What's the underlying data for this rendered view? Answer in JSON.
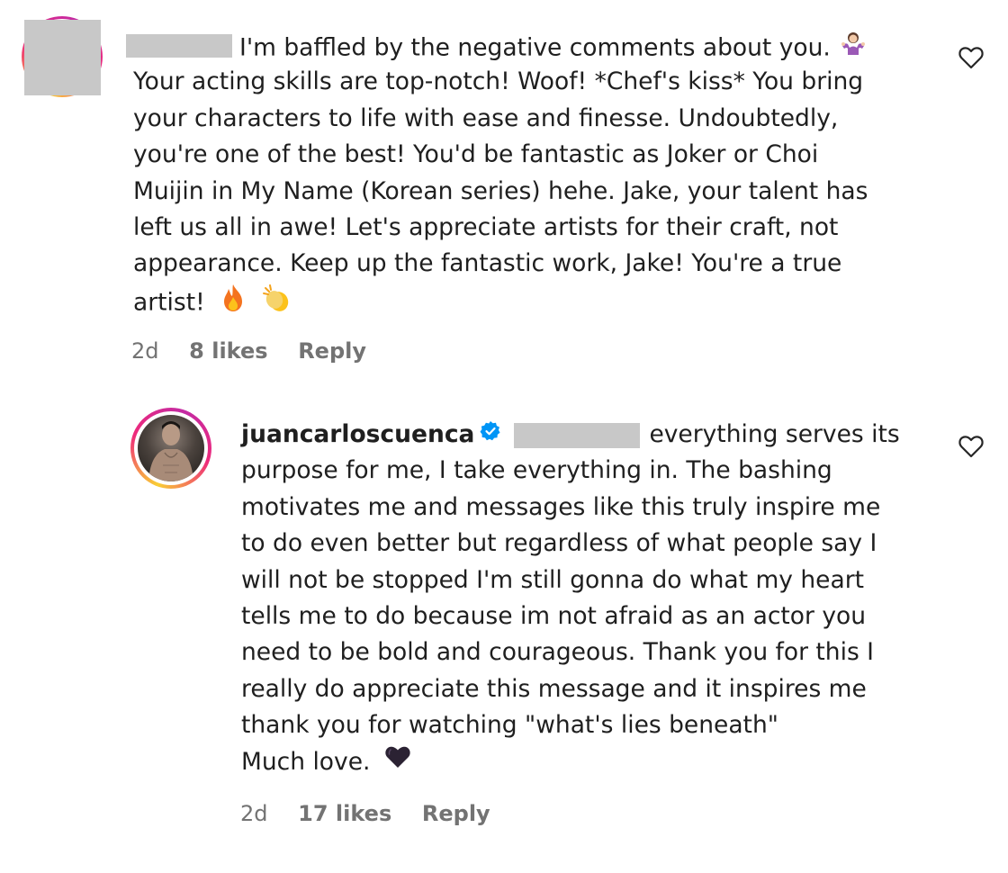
{
  "comment1": {
    "redacted_username": true,
    "lines": [
      "I'm baffled by the negative comments about you.",
      "Your acting skills are top-notch! Woof! *Chef's kiss* You bring",
      "your characters to life with ease and finesse. Undoubtedly,",
      "you're one of the best! You'd be fantastic as Joker or Choi",
      "Muijin in My Name (Korean series) hehe. Jake, your talent has",
      "left us all in awe! Let's appreciate artists for their craft, not",
      "appearance. Keep up the fantastic work, Jake! You're a true",
      "artist!"
    ],
    "emojis": [
      "person-shrugging-icon",
      "fire-icon",
      "clapping-hands-icon"
    ],
    "time": "2d",
    "likes": "8 likes",
    "reply": "Reply"
  },
  "comment2": {
    "username": "juancarloscuenca",
    "verified": true,
    "lines": [
      "everything serves its",
      "purpose for me, I take everything in. The bashing",
      "motivates me and messages like this truly inspire me",
      "to do even better but regardless of what people say I",
      "will not be stopped I'm still gonna do what my heart",
      "tells me to do because im not afraid as an actor you",
      "need to be bold and courageous. Thank you for this I",
      "really do appreciate this message and it inspires me",
      "thank you for watching \"what's lies beneath\"",
      "Much love."
    ],
    "emojis": [
      "black-heart-icon"
    ],
    "time": "2d",
    "likes": "17 likes",
    "reply": "Reply"
  },
  "colors": {
    "text": "#1f1f1f",
    "meta": "#737373",
    "verified": "#0095f6",
    "redaction": "#c8c8c8"
  }
}
